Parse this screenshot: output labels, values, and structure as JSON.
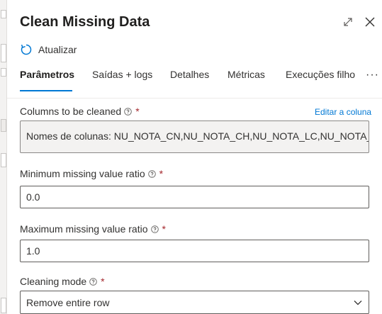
{
  "panel": {
    "title": "Clean Missing Data",
    "refresh_label": "Atualizar"
  },
  "tabs": [
    {
      "label": "Parâmetros",
      "active": true
    },
    {
      "label": "Saídas + logs",
      "active": false
    },
    {
      "label": "Detalhes",
      "active": false
    },
    {
      "label": "Métricas",
      "active": false
    },
    {
      "label": "Execuções filho",
      "active": false
    }
  ],
  "tabs_more": "···",
  "fields": {
    "columns": {
      "label": "Columns to be cleaned",
      "required": "*",
      "edit_link": "Editar a coluna",
      "value": "Nomes de colunas: NU_NOTA_CN,NU_NOTA_CH,NU_NOTA_LC,NU_NOTA_MT"
    },
    "min_ratio": {
      "label": "Minimum missing value ratio",
      "required": "*",
      "value": "0.0"
    },
    "max_ratio": {
      "label": "Maximum missing value ratio",
      "required": "*",
      "value": "1.0"
    },
    "cleaning_mode": {
      "label": "Cleaning mode",
      "required": "*",
      "value": "Remove entire row"
    }
  },
  "colors": {
    "accent": "#0078d4",
    "required": "#a4262c",
    "text": "#323130"
  },
  "icons": {
    "expand": "expand-icon",
    "close": "close-icon",
    "refresh": "refresh-icon",
    "help": "help-icon",
    "chevron": "chevron-down-icon"
  }
}
